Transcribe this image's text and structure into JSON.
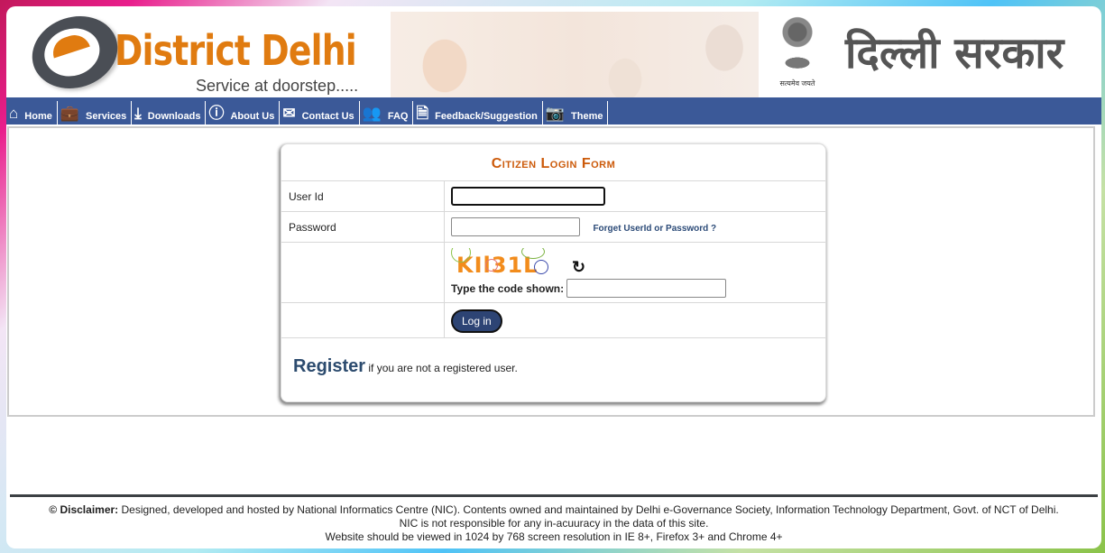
{
  "header": {
    "logo_title": "District Delhi",
    "logo_tagline": "Service at doorstep.....",
    "emblem_motto": "सत्यमेव जयते",
    "hindi_title": "दिल्ली सरकार"
  },
  "nav": {
    "items": [
      {
        "label": "Home",
        "icon": "home-icon"
      },
      {
        "label": "Services",
        "icon": "briefcase-icon"
      },
      {
        "label": "Downloads",
        "icon": "download-icon"
      },
      {
        "label": "About Us",
        "icon": "info-icon"
      },
      {
        "label": "Contact Us",
        "icon": "envelope-icon"
      },
      {
        "label": "FAQ",
        "icon": "users-icon"
      },
      {
        "label": "Feedback/Suggestion",
        "icon": "document-icon"
      },
      {
        "label": "Theme",
        "icon": "camera-icon"
      }
    ]
  },
  "login_form": {
    "title": "Citizen Login Form",
    "user_id_label": "User Id",
    "user_id_value": "",
    "password_label": "Password",
    "password_value": "",
    "forgot_link": "Forget UserId or Password ?",
    "captcha_text": "KIl31L",
    "captcha_prompt": "Type the code shown:",
    "captcha_value": "",
    "login_button": "Log in",
    "register_link": "Register",
    "register_text": " if you are not a registered user."
  },
  "footer": {
    "disclaimer_label": "© Disclaimer:",
    "disclaimer_text": " Designed, developed and hosted by National Informatics Centre (NIC). Contents owned and maintained by Delhi e-Governance Society, Information Technology Department, Govt. of NCT of Delhi.",
    "line2": "NIC is not responsible for any in-acuuracy in the data of this site.",
    "line3": "Website should be viewed in 1024 by 768 screen resolution in IE 8+, Firefox 3+ and Chrome 4+"
  }
}
